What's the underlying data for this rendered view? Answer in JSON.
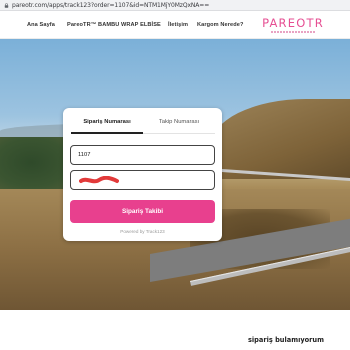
{
  "browser": {
    "url": "pareotr.com/apps/track123?order=1107&id=NTM1MjY0MzQxNA=="
  },
  "nav": {
    "items": [
      {
        "label": "Ana Sayfa"
      },
      {
        "label": "PareoTR™ BAMBU WRAP ELBİSE"
      },
      {
        "label": "İletişim"
      },
      {
        "label": "Kargom Nerede?"
      }
    ],
    "logo": "PAREOTR"
  },
  "tracker": {
    "tabs": [
      {
        "label": "Sipariş Numarası",
        "active": true
      },
      {
        "label": "Takip Numarası",
        "active": false
      }
    ],
    "order_value": "1107",
    "email_value": "",
    "button_label": "Sipariş Takibi",
    "powered_by": "Powered by Track123"
  },
  "caption": "sipariş bulamıyorum",
  "colors": {
    "accent": "#e8408e",
    "logo": "#e64f93",
    "redaction": "#e23a3a"
  }
}
